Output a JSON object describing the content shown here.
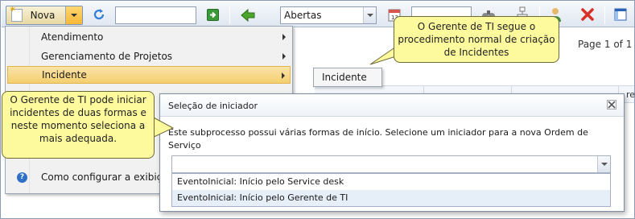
{
  "toolbar": {
    "new_label": "Nova",
    "status_filter": "Abertas"
  },
  "pager": {
    "text": "Page 1 of 1"
  },
  "grid": {
    "partial_header": "rego"
  },
  "menu": {
    "items": [
      {
        "label": "Atendimento"
      },
      {
        "label": "Gerenciamento de Projetos"
      },
      {
        "label": "Incidente"
      },
      {
        "label": "Como configurar a exibição"
      }
    ]
  },
  "submenu": {
    "item": "Incidente"
  },
  "callouts": {
    "top": "O Gerente de TI segue o procedimento normal de criação de Incidentes",
    "left": "O Gerente de TI pode iniciar incidentes de duas formas e neste momento seleciona a mais adequada."
  },
  "dialog": {
    "title": "Seleção de iniciador",
    "message": "Este subprocesso possui várias formas de início. Selecione um iniciador para a nova Ordem de Serviço",
    "options": [
      {
        "label": "EventoInicial: Início pelo Service desk"
      },
      {
        "label": "EventoInicial: Início pelo Gerente de TI"
      }
    ]
  },
  "colors": {
    "callout_bg": "#fdfa9e",
    "menu_highlight": "#f4cf6f",
    "toolbar_bg": "#dfe7f1"
  },
  "icons": [
    "new-doc-icon",
    "refresh-icon",
    "go-icon",
    "back-icon",
    "calendar-icon",
    "binoculars-icon",
    "hierarchy-icon",
    "user-icon",
    "delete-icon",
    "layout-icon",
    "help-icon",
    "close-icon"
  ]
}
